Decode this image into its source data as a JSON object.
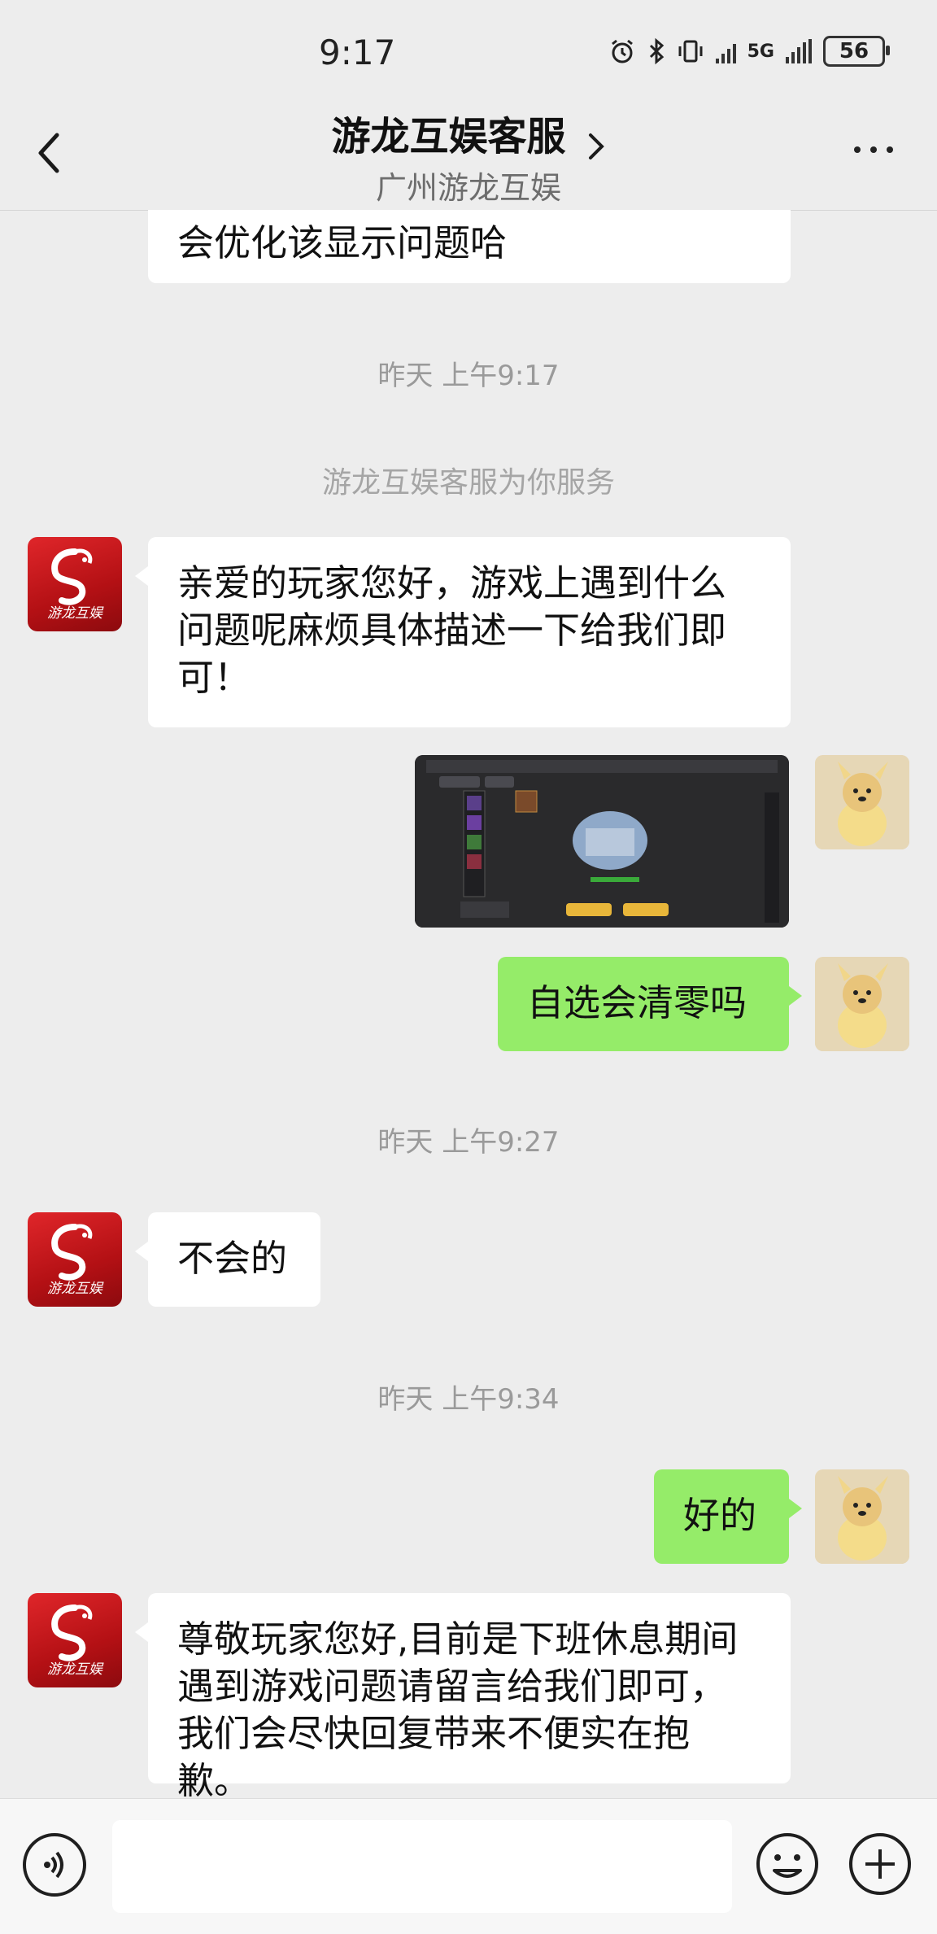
{
  "status_bar": {
    "time": "9:17",
    "network": "5G",
    "battery": "56"
  },
  "header": {
    "title": "游龙互娱客服",
    "subtitle": "广州游龙互娱"
  },
  "messages": {
    "m0": "会优化该显示问题哈",
    "ts1": "昨天 上午9:17",
    "sys1": "游龙互娱客服为你服务",
    "m1": "亲爱的玩家您好，游戏上遇到什么问题呢麻烦具体描述一下给我们即可！",
    "m2": "自选会清零吗",
    "ts2": "昨天 上午9:27",
    "m3": "不会的",
    "ts3": "昨天 上午9:34",
    "m4": "好的",
    "m5": "尊敬玩家您好,目前是下班休息期间遇到游戏问题请留言给我们即可，我们会尽快回复带来不便实在抱歉。"
  },
  "avatar": {
    "service_logo_text": "游龙互娱"
  },
  "colors": {
    "background": "#ededed",
    "my_bubble": "#95ec69",
    "their_bubble": "#ffffff",
    "service_avatar": "#c8161d"
  },
  "icons": {
    "back": "chevron-left-icon",
    "title_chevron": "chevron-right-icon",
    "more": "more-dots-icon",
    "voice": "voice-icon",
    "emoji": "emoji-icon",
    "plus": "plus-icon"
  }
}
